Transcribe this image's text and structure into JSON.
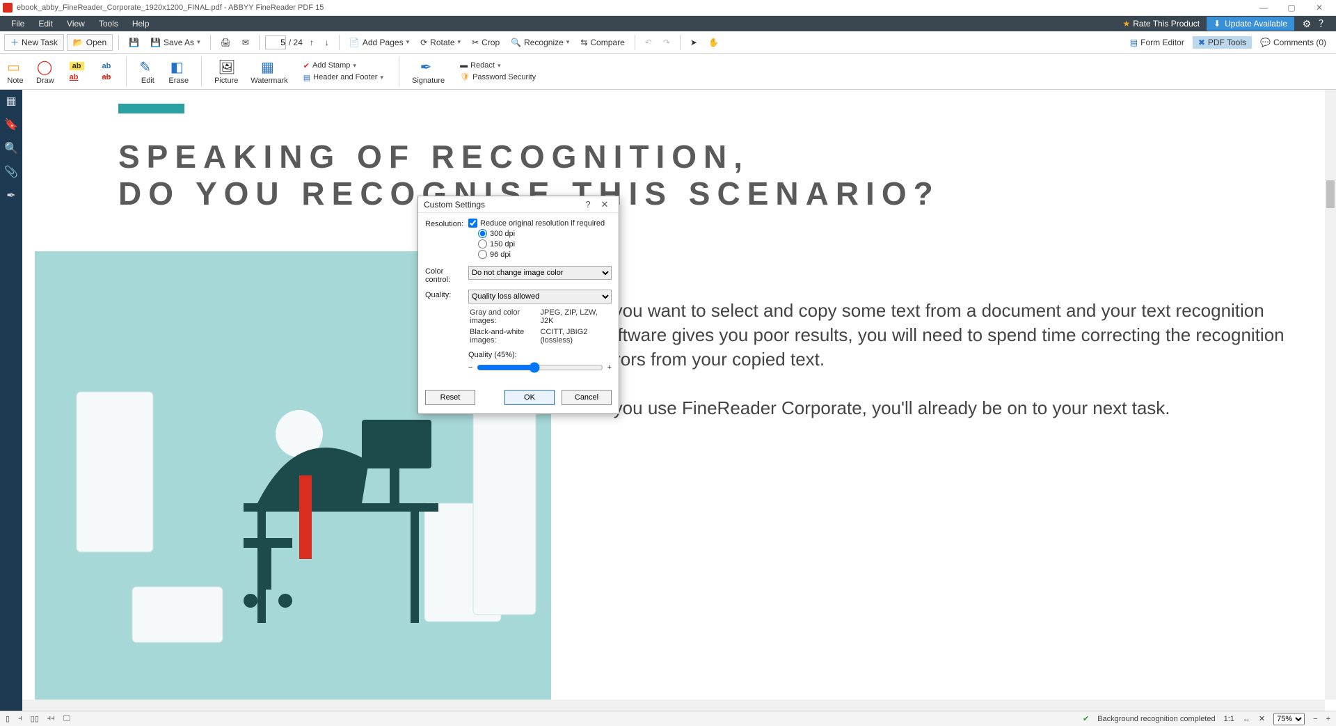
{
  "app": {
    "document_name": "ebook_abby_FineReader_Corporate_1920x1200_FINAL.pdf",
    "app_name": "ABBYY FineReader PDF 15"
  },
  "window_controls": {
    "min": "—",
    "max": "▢",
    "close": "✕"
  },
  "menubar": {
    "items": [
      "File",
      "Edit",
      "View",
      "Tools",
      "Help"
    ],
    "rate": "Rate This Product",
    "update": "Update Available"
  },
  "toolbar": {
    "new_task": "New Task",
    "open": "Open",
    "save_as": "Save As",
    "page_current": "5",
    "page_total": "/ 24",
    "add_pages": "Add Pages",
    "rotate": "Rotate",
    "crop": "Crop",
    "recognize": "Recognize",
    "compare": "Compare",
    "form_editor": "Form Editor",
    "pdf_tools": "PDF Tools",
    "comments": "Comments (0)"
  },
  "ribbon": {
    "note": "Note",
    "draw": "Draw",
    "edit": "Edit",
    "erase": "Erase",
    "picture": "Picture",
    "watermark": "Watermark",
    "add_stamp": "Add Stamp",
    "header_footer": "Header and Footer",
    "signature": "Signature",
    "redact": "Redact",
    "password": "Password Security"
  },
  "document": {
    "heading_line1": "SPEAKING OF RECOGNITION,",
    "heading_line2": "DO YOU RECOGNISE THIS SCENARIO?",
    "para1": "If you want to select and copy some text from a document and your text recognition software gives you poor results, you will need to spend time correcting the recognition errors from your copied text.",
    "para2": "If you use FineReader Corporate, you'll already be on to your next task."
  },
  "dialog": {
    "title": "Custom Settings",
    "resolution_label": "Resolution:",
    "reduce_label": "Reduce original resolution if required",
    "opt_300": "300 dpi",
    "opt_150": "150 dpi",
    "opt_96": "96 dpi",
    "color_label": "Color control:",
    "color_value": "Do not change image color",
    "quality_label": "Quality:",
    "quality_value": "Quality loss allowed",
    "gray_label": "Gray and color images:",
    "gray_value": "JPEG, ZIP, LZW, J2K",
    "bw_label": "Black-and-white images:",
    "bw_value": "CCITT, JBIG2 (lossless)",
    "quality_pct_label": "Quality (45%):",
    "reset": "Reset",
    "ok": "OK",
    "cancel": "Cancel"
  },
  "statusbar": {
    "recognition": "Background recognition completed",
    "fit": "1:1",
    "zoom": "75%"
  }
}
